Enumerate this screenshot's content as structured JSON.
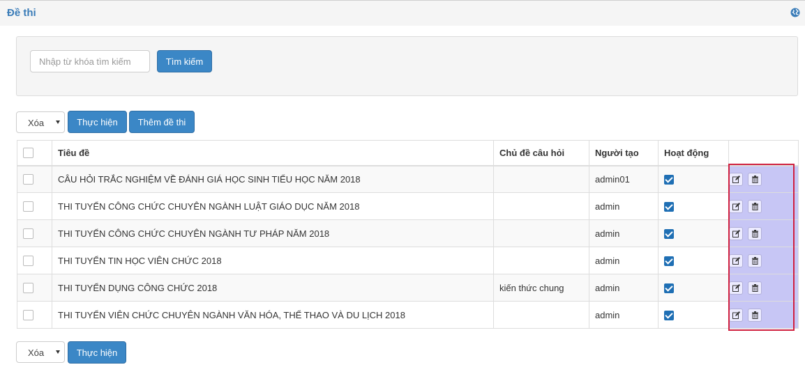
{
  "header": {
    "title": "Đề thi",
    "icon": "globe-icon"
  },
  "search": {
    "placeholder": "Nhập từ khóa tìm kiếm",
    "value": "",
    "button_label": "Tìm kiếm"
  },
  "toolbar_top": {
    "bulk_action": "Xóa",
    "execute_label": "Thực hiện",
    "add_label": "Thêm đề thi"
  },
  "toolbar_bottom": {
    "bulk_action": "Xóa",
    "execute_label": "Thực hiện"
  },
  "table": {
    "columns": {
      "title": "Tiêu đề",
      "topic": "Chủ đề câu hỏi",
      "creator": "Người tạo",
      "active": "Hoạt động"
    },
    "rows": [
      {
        "title": "CÂU HỎI TRẮC NGHIỆM VỀ ĐÁNH GIÁ HỌC SINH TIỂU HỌC NĂM 2018",
        "topic": "",
        "creator": "admin01",
        "active": true
      },
      {
        "title": "THI TUYỂN CÔNG CHỨC CHUYÊN NGÀNH LUẬT GIÁO DỤC NĂM 2018",
        "topic": "",
        "creator": "admin",
        "active": true
      },
      {
        "title": "THI TUYỂN CÔNG CHỨC CHUYÊN NGÀNH TƯ PHÁP NĂM 2018",
        "topic": "",
        "creator": "admin",
        "active": true
      },
      {
        "title": "THI TUYỂN TIN HỌC VIÊN CHỨC 2018",
        "topic": "",
        "creator": "admin",
        "active": true
      },
      {
        "title": "THI TUYỂN DỤNG CÔNG CHỨC 2018",
        "topic": "kiến thức chung",
        "creator": "admin",
        "active": true
      },
      {
        "title": "THI TUYỂN VIÊN CHỨC CHUYÊN NGÀNH VĂN HÓA, THỂ THAO VÀ DU LỊCH 2018",
        "topic": "",
        "creator": "admin",
        "active": true
      }
    ]
  },
  "colors": {
    "accent": "#3b87c6",
    "link": "#2a7bb0",
    "highlight_border": "#d0203f",
    "action_column": "#c7c6f5"
  },
  "row_action_icons": [
    "edit-icon",
    "trash-icon"
  ]
}
